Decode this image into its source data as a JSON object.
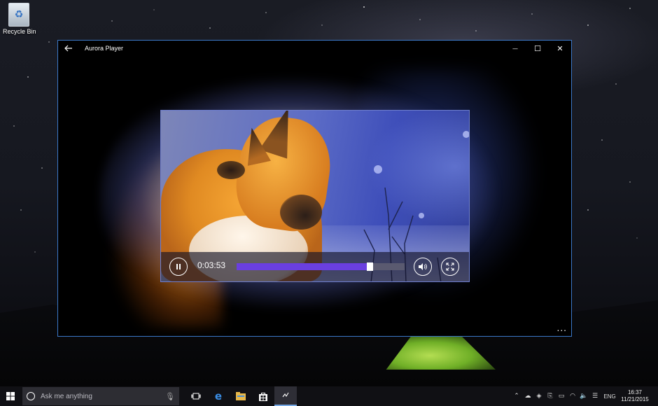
{
  "desktop": {
    "recycle_bin_label": "Recycle Bin"
  },
  "window": {
    "title": "Aurora Player",
    "back_icon": "arrow-left-icon",
    "controls": {
      "minimize": "—",
      "maximize": "☐",
      "close": "✕"
    },
    "accent_color": "#3b78c8"
  },
  "player": {
    "time": "0:03:53",
    "progress": 0.79,
    "progress_color": "#6a3fe0",
    "play_state_icon": "pause-icon",
    "volume_icon": "volume-icon",
    "fullscreen_icon": "fullscreen-icon",
    "more_label": "..."
  },
  "taskbar": {
    "search_placeholder": "Ask me anything",
    "pinned": [
      {
        "name": "task-view-icon"
      },
      {
        "name": "edge-icon"
      },
      {
        "name": "file-explorer-icon"
      },
      {
        "name": "store-icon"
      },
      {
        "name": "aurora-player-icon",
        "active": true
      }
    ],
    "tray": {
      "lang": "ENG",
      "time": "16:37",
      "date": "11/21/2015"
    }
  }
}
